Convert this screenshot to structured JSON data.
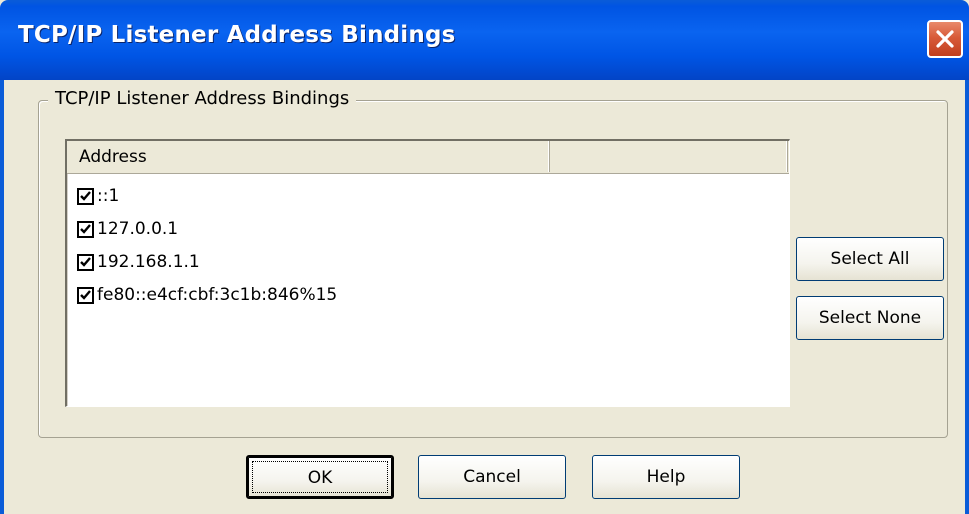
{
  "window": {
    "title": "TCP/IP Listener Address Bindings"
  },
  "group": {
    "label": "TCP/IP Listener Address Bindings"
  },
  "list": {
    "columns": [
      "Address",
      ""
    ],
    "rows": [
      {
        "address": "::1",
        "checked": true
      },
      {
        "address": "127.0.0.1",
        "checked": true
      },
      {
        "address": "192.168.1.1",
        "checked": true
      },
      {
        "address": "fe80::e4cf:cbf:3c1b:846%15",
        "checked": true
      }
    ]
  },
  "side_buttons": {
    "select_all": "Select All",
    "select_none": "Select None"
  },
  "footer_buttons": {
    "ok": "OK",
    "cancel": "Cancel",
    "help": "Help"
  },
  "icons": {
    "close": "close-icon",
    "checkbox": "checkmark-icon"
  },
  "colors": {
    "titlebar": "#0054e3",
    "close_button": "#d85b39",
    "dialog_background": "#ece9d8"
  }
}
